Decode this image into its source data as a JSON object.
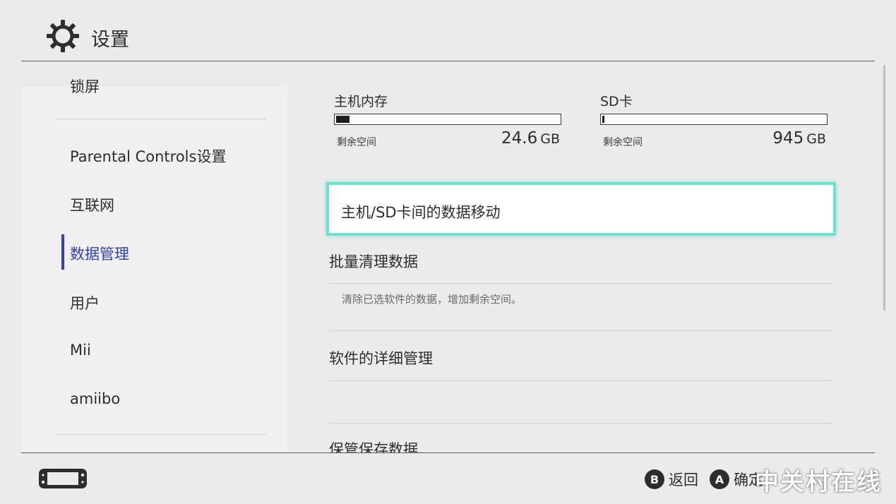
{
  "header": {
    "title": "设置",
    "icon": "gear-icon"
  },
  "sidebar": {
    "items": [
      {
        "label": "锁屏"
      },
      {
        "label": "Parental Controls设置"
      },
      {
        "label": "互联网"
      },
      {
        "label": "数据管理",
        "active": true
      },
      {
        "label": "用户"
      },
      {
        "label": "Mii"
      },
      {
        "label": "amiibo"
      }
    ]
  },
  "storage": {
    "console": {
      "label": "主机内存",
      "free_label": "剩余空间",
      "free_value": "24.6",
      "free_unit": "GB",
      "used_fraction": 0.06
    },
    "sd": {
      "label": "SD卡",
      "free_label": "剩余空间",
      "free_value": "945",
      "free_unit": "GB",
      "used_fraction": 0.01
    }
  },
  "menu": {
    "items": [
      {
        "label": "主机/SD卡间的数据移动",
        "focused": true
      },
      {
        "label": "批量清理数据",
        "description": "清除已选软件的数据，增加剩余空间。"
      },
      {
        "label": "软件的详细管理"
      },
      {
        "label": "保管保存数据"
      }
    ]
  },
  "footer": {
    "back_label": "返回",
    "back_button": "B",
    "confirm_label": "确定",
    "confirm_button": "A",
    "watermark": "中关村在线"
  },
  "colors": {
    "accent": "#2f42b0",
    "focus": "#6be0d3",
    "background": "#ebebeb"
  }
}
